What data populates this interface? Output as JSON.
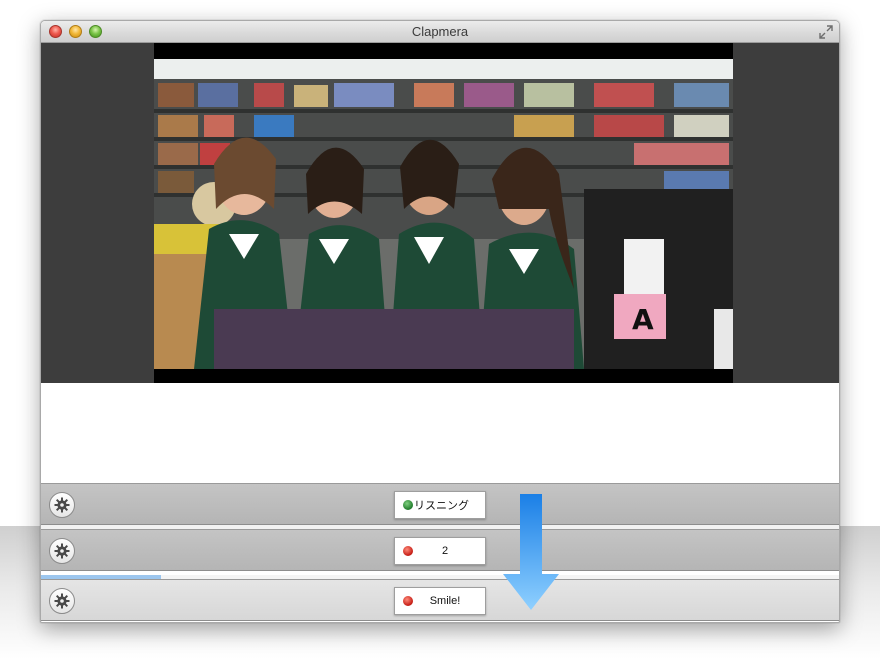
{
  "window": {
    "title": "Clapmera"
  },
  "icons": {
    "close": "close-icon",
    "minimize": "minimize-icon",
    "zoom": "zoom-icon",
    "fullscreen": "fullscreen-icon",
    "gear": "gear-icon",
    "arrow": "arrow-down-icon"
  },
  "colors": {
    "status_ready": "#1f7a2a",
    "status_recording": "#c41a12",
    "arrow": "#2e9cf2",
    "progress": "#9cc6ee"
  },
  "rows": [
    {
      "status_label": "リスニング",
      "status_color": "green"
    },
    {
      "status_label": "2",
      "status_color": "red"
    },
    {
      "status_label": "Smile!",
      "status_color": "red"
    }
  ],
  "progress": {
    "fraction": 0.15
  }
}
